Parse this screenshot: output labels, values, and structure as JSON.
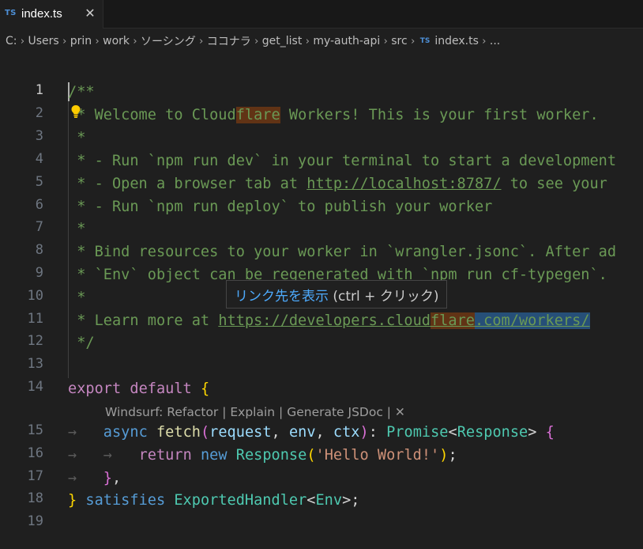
{
  "tab": {
    "icon": "TS",
    "label": "index.ts",
    "close": "✕"
  },
  "breadcrumb": {
    "items": [
      "C:",
      "Users",
      "prin",
      "work",
      "ソーシング",
      "ココナラ",
      "get_list",
      "my-auth-api",
      "src",
      "index.ts",
      "..."
    ],
    "file_icon": "TS",
    "separator": "›"
  },
  "editor": {
    "line_numbers": [
      "1",
      "2",
      "3",
      "4",
      "5",
      "6",
      "7",
      "8",
      "9",
      "10",
      "11",
      "12",
      "13",
      "14",
      "15",
      "16",
      "17",
      "18",
      "19"
    ],
    "active_line": "1",
    "code": {
      "l1": "/**",
      "l2_a": " * Welcome to Cloud",
      "l2_hl": "flare",
      "l2_b": " Workers! This is your first worker.",
      "l3": " *",
      "l4": " * - Run `npm run dev` in your terminal to start a development",
      "l5_a": " * - Open a browser tab at ",
      "l5_link": "http://localhost:8787/",
      "l5_b": " to see your",
      "l6": " * - Run `npm run deploy` to publish your worker",
      "l7": " *",
      "l8": " * Bind resources to your worker in `wrangler.jsonc`. After ad",
      "l9": " * `Env` object can be regenerated with `npm run cf-typegen`.",
      "l10": " *",
      "l11_a": " * Learn more at ",
      "l11_link_a": "https://developers.cloud",
      "l11_link_hl": "flare",
      "l11_link_b": ".com/workers/",
      "l12": " */",
      "l14_kw1": "export",
      "l14_kw2": "default",
      "l14_brace": "{",
      "l15_arrow": "→",
      "l15_async": "async",
      "l15_fn": "fetch",
      "l15_p1": "request",
      "l15_p2": "env",
      "l15_p3": "ctx",
      "l15_type1": "Promise",
      "l15_type2": "Response",
      "l16_arrow1": "→",
      "l16_arrow2": "→",
      "l16_return": "return",
      "l16_new": "new",
      "l16_type": "Response",
      "l16_str": "'Hello World!'",
      "l17_arrow": "→",
      "l18_brace": "}",
      "l18_kw": "satisfies",
      "l18_type1": "ExportedHandler",
      "l18_type2": "Env"
    },
    "tooltip": {
      "link_text": "リンク先を表示",
      "hint": "(ctrl + クリック)"
    },
    "codelens": "Windsurf: Refactor | Explain | Generate JSDoc | ✕"
  },
  "colors": {
    "background": "#1f1f1f",
    "comment": "#6a9955",
    "keyword": "#569cd6",
    "control": "#c586c0",
    "function": "#dcdcaa",
    "variable": "#9cdcfe",
    "type": "#4ec9b0",
    "string": "#ce9178",
    "match_highlight": "#613315"
  },
  "icons": {
    "lightbulb": "lightbulb-icon",
    "ts_file": "typescript-file-icon",
    "close": "close-icon"
  }
}
